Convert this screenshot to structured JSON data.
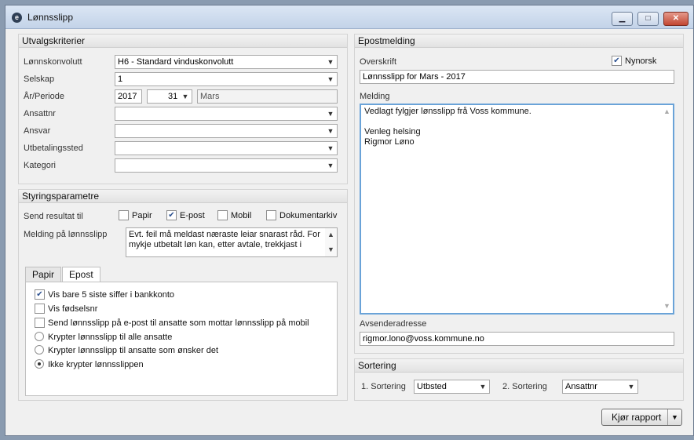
{
  "window": {
    "title": "Lønnsslipp",
    "app_icon": "e-logo-icon"
  },
  "utvalg": {
    "heading": "Utvalgskriterier",
    "fields": [
      {
        "label": "Lønnskonvolutt",
        "value": "H6 - Standard vinduskonvolutt"
      },
      {
        "label": "Selskap",
        "value": "1"
      },
      {
        "label": "År/Periode",
        "year": "2017",
        "period": "31",
        "month": "Mars"
      },
      {
        "label": "Ansattnr",
        "value": ""
      },
      {
        "label": "Ansvar",
        "value": ""
      },
      {
        "label": "Utbetalingssted",
        "value": ""
      },
      {
        "label": "Kategori",
        "value": ""
      }
    ]
  },
  "styring": {
    "heading": "Styringsparametre",
    "send_label": "Send resultat til",
    "send_options": [
      {
        "label": "Papir",
        "checked": false
      },
      {
        "label": "E-post",
        "checked": true
      },
      {
        "label": "Mobil",
        "checked": false
      },
      {
        "label": "Dokumentarkiv",
        "checked": false
      }
    ],
    "melding_label": "Melding på lønnsslipp",
    "melding_text": "Evt. feil må meldast næraste leiar snarast råd. For mykje utbetalt løn kan, etter avtale, trekkjast i"
  },
  "tabs": [
    {
      "label": "Papir",
      "active": false
    },
    {
      "label": "Epost",
      "active": true
    }
  ],
  "epost_options": {
    "checkboxes": [
      {
        "label": "Vis bare 5 siste siffer i bankkonto",
        "checked": true
      },
      {
        "label": "Vis fødselsnr",
        "checked": false
      },
      {
        "label": "Send lønnsslipp på e-post til ansatte som mottar lønnsslipp på mobil",
        "checked": false
      }
    ],
    "radios": [
      {
        "label": "Krypter lønnsslipp til alle ansatte",
        "selected": false
      },
      {
        "label": "Krypter lønnsslipp til ansatte som ønsker det",
        "selected": false
      },
      {
        "label": "Ikke krypter lønnsslippen",
        "selected": true
      }
    ]
  },
  "epost": {
    "heading": "Epostmelding",
    "overskrift_label": "Overskrift",
    "nynorsk_label": "Nynorsk",
    "nynorsk_checked": true,
    "overskrift_value": "Lønnsslipp for Mars - 2017",
    "melding_label": "Melding",
    "melding_lines": [
      "Vedlagt fylgjer lønsslipp frå Voss kommune.",
      "",
      "Venleg helsing",
      "Rigmor Løno"
    ],
    "avsender_label": "Avsenderadresse",
    "avsender_value": "rigmor.lono@voss.kommune.no"
  },
  "sortering": {
    "heading": "Sortering",
    "sort1_label": "1. Sortering",
    "sort1_value": "Utbsted",
    "sort2_label": "2. Sortering",
    "sort2_value": "Ansattnr"
  },
  "report_button": {
    "label": "Kjør rapport"
  }
}
